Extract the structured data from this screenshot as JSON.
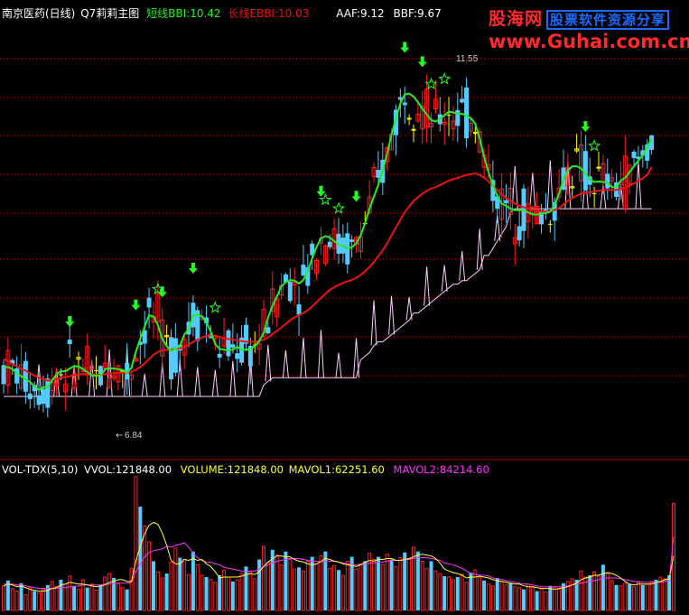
{
  "header": {
    "stock": "南京医药(日线)",
    "indicator": "Q7莉莉主图",
    "short_bbi_label": "短线BBI:",
    "short_bbi_value": "10.42",
    "long_bbi_label": "长线EBBI:",
    "long_bbi_value": "10.03",
    "aaf_label": "AAF:",
    "aaf_value": "9.12",
    "bbf_label": "BBF:",
    "bbf_value": "9.67"
  },
  "watermark": {
    "brand": "股海网",
    "slogan": "股票软件资源分享",
    "url": "www.Guhai.com.cn"
  },
  "price_annotations": {
    "high_label": "11.55",
    "low_label": "6.84"
  },
  "volume_header": {
    "name": "VOL-TDX(5,10)",
    "vvol": "VVOL:121848.00",
    "volume": "VOLUME:121848.00",
    "mavol1": "MAVOL1:62251.60",
    "mavol2": "MAVOL2:84214.60"
  },
  "colors": {
    "background": "#000000",
    "up": "#ff2020",
    "down": "#55ccff",
    "doji": "#ffff00",
    "short_bbi": "#22ee22",
    "long_bbi": "#ee1111",
    "support": "#ffd0ff",
    "mavol1": "#ffff33",
    "mavol2": "#ff33ff",
    "signal": "#22ff22",
    "grid": "#d00000"
  },
  "chart_data": {
    "type": "candlestick",
    "x_count": 153,
    "price_range": [
      6.2,
      12.0
    ],
    "volume_range": [
      0,
      155000
    ],
    "short_bbi_series": [
      7.24,
      7.25,
      7.22,
      7.16,
      7.12,
      7.08,
      7.04,
      6.98,
      6.93,
      6.97,
      6.97,
      7.06,
      7.15,
      7.19,
      7.19,
      7.23,
      7.26,
      7.26,
      7.22,
      7.18,
      7.13,
      7.13,
      7.13,
      7.22,
      7.23,
      7.23,
      7.22,
      7.21,
      7.17,
      7.24,
      7.46,
      7.64,
      7.81,
      7.97,
      7.95,
      7.83,
      7.64,
      7.54,
      7.47,
      7.5,
      7.55,
      7.7,
      7.78,
      7.97,
      7.98,
      7.95,
      7.87,
      7.74,
      7.57,
      7.5,
      7.49,
      7.48,
      7.49,
      7.53,
      7.49,
      7.49,
      7.5,
      7.54,
      7.61,
      7.72,
      7.94,
      8.1,
      8.23,
      8.37,
      8.43,
      8.46,
      8.45,
      8.41,
      8.46,
      8.58,
      8.76,
      8.92,
      9.04,
      9.07,
      9.05,
      9.0,
      8.95,
      8.93,
      8.9,
      8.91,
      8.97,
      9.08,
      9.25,
      9.45,
      9.62,
      9.78,
      9.98,
      10.21,
      10.48,
      10.71,
      10.91,
      11.04,
      11.05,
      11.01,
      10.93,
      10.84,
      10.76,
      10.68,
      10.66,
      10.7,
      10.75,
      10.8,
      10.79,
      10.77,
      10.77,
      10.74,
      10.71,
      10.63,
      10.43,
      10.17,
      9.96,
      9.77,
      9.63,
      9.52,
      9.49,
      9.45,
      9.43,
      9.43,
      9.43,
      9.4,
      9.37,
      9.37,
      9.38,
      9.39,
      9.41,
      9.5,
      9.66,
      9.86,
      9.98,
      10.04,
      10.04,
      10.01,
      9.94,
      9.86,
      9.82,
      9.83,
      9.82,
      9.81,
      9.75,
      9.75,
      9.84,
      9.88,
      9.96,
      10.04,
      10.12,
      10.19,
      10.31,
      10.42
    ],
    "long_bbi_series": [
      7.36,
      7.33,
      7.29,
      7.26,
      7.22,
      7.2,
      7.16,
      7.13,
      7.1,
      7.08,
      7.06,
      7.07,
      7.08,
      7.1,
      7.11,
      7.12,
      7.14,
      7.15,
      7.15,
      7.15,
      7.15,
      7.14,
      7.14,
      7.15,
      7.16,
      7.16,
      7.17,
      7.17,
      7.17,
      7.18,
      7.21,
      7.25,
      7.3,
      7.36,
      7.42,
      7.46,
      7.48,
      7.49,
      7.49,
      7.5,
      7.51,
      7.53,
      7.56,
      7.6,
      7.63,
      7.66,
      7.68,
      7.69,
      7.68,
      7.67,
      7.65,
      7.64,
      7.63,
      7.62,
      7.61,
      7.6,
      7.6,
      7.6,
      7.61,
      7.63,
      7.66,
      7.71,
      7.75,
      7.8,
      7.85,
      7.9,
      7.94,
      7.97,
      8.0,
      8.04,
      8.09,
      8.15,
      8.21,
      8.27,
      8.32,
      8.36,
      8.39,
      8.42,
      8.44,
      8.46,
      8.49,
      8.53,
      8.58,
      8.64,
      8.71,
      8.79,
      8.87,
      8.97,
      9.08,
      9.19,
      9.3,
      9.4,
      9.48,
      9.56,
      9.61,
      9.66,
      9.7,
      9.73,
      9.75,
      9.78,
      9.81,
      9.84,
      9.86,
      9.88,
      9.9,
      9.92,
      9.93,
      9.94,
      9.92,
      9.88,
      9.83,
      9.77,
      9.71,
      9.65,
      9.6,
      9.56,
      9.52,
      9.49,
      9.47,
      9.45,
      9.43,
      9.42,
      9.41,
      9.41,
      9.41,
      9.43,
      9.46,
      9.51,
      9.56,
      9.6,
      9.63,
      9.66,
      9.67,
      9.68,
      9.69,
      9.7,
      9.71,
      9.71,
      9.71,
      9.71,
      9.73,
      9.74,
      9.77,
      9.8,
      9.84,
      9.87,
      9.92,
      10.03
    ],
    "support_series": [
      6.84,
      6.84,
      6.84,
      6.84,
      6.84,
      6.84,
      6.84,
      6.84,
      6.84,
      6.84,
      6.84,
      6.84,
      6.84,
      6.84,
      6.84,
      6.84,
      6.84,
      6.84,
      6.84,
      6.84,
      6.84,
      6.84,
      6.84,
      6.84,
      6.84,
      6.84,
      6.84,
      6.84,
      6.84,
      6.84,
      6.84,
      6.84,
      6.84,
      6.84,
      6.84,
      6.84,
      6.84,
      6.84,
      6.84,
      6.84,
      6.84,
      6.84,
      6.84,
      6.84,
      6.84,
      6.84,
      6.84,
      6.84,
      6.84,
      6.84,
      6.84,
      6.84,
      6.84,
      6.84,
      6.84,
      6.84,
      6.84,
      6.84,
      6.84,
      7.0,
      7.05,
      7.1,
      7.1,
      7.1,
      7.1,
      7.1,
      7.1,
      7.1,
      7.1,
      7.1,
      7.1,
      7.1,
      7.1,
      7.1,
      7.1,
      7.1,
      7.1,
      7.1,
      7.1,
      7.1,
      7.1,
      7.35,
      7.4,
      7.45,
      7.55,
      7.6,
      7.6,
      7.65,
      7.7,
      7.75,
      7.8,
      7.85,
      7.9,
      8.0,
      8.0,
      8.05,
      8.1,
      8.15,
      8.2,
      8.25,
      8.3,
      8.35,
      8.4,
      8.4,
      8.45,
      8.45,
      8.5,
      8.55,
      8.6,
      8.8,
      8.8,
      8.9,
      9.0,
      9.1,
      9.2,
      9.4,
      9.45,
      9.45,
      9.45,
      9.45,
      9.45,
      9.45,
      9.45,
      9.45,
      9.45,
      9.45,
      9.45,
      9.45,
      9.45,
      9.45,
      9.45,
      9.45,
      9.45,
      9.45,
      9.45,
      9.45,
      9.45,
      9.45,
      9.45,
      9.45,
      9.45,
      9.45,
      9.45,
      9.45,
      9.45,
      9.45,
      9.45,
      9.45
    ],
    "signal_arrows_at": [
      15,
      30,
      36,
      43,
      72,
      80,
      91,
      95,
      132
    ],
    "signal_stars_at": [
      35,
      48,
      73,
      76,
      97,
      100,
      134
    ],
    "volume_values": [
      28000,
      34000,
      25000,
      22000,
      31000,
      18000,
      26000,
      22000,
      20000,
      24000,
      29000,
      33000,
      27000,
      35000,
      30000,
      39000,
      28000,
      24000,
      35000,
      26000,
      30000,
      23000,
      28000,
      38000,
      42000,
      37000,
      31000,
      26000,
      24000,
      48000,
      152000,
      118000,
      96000,
      78000,
      56000,
      44000,
      37000,
      42000,
      55000,
      71000,
      60000,
      58000,
      41000,
      67000,
      52000,
      40000,
      38000,
      35000,
      32000,
      40000,
      46000,
      38000,
      33000,
      35000,
      42000,
      50000,
      44000,
      36000,
      58000,
      73000,
      55000,
      69000,
      63000,
      52000,
      67000,
      58000,
      47000,
      49000,
      45000,
      56000,
      61000,
      53000,
      62000,
      67000,
      48000,
      51000,
      46000,
      40000,
      56000,
      61000,
      47000,
      53000,
      56000,
      65000,
      58000,
      61000,
      52000,
      64000,
      58000,
      50000,
      60000,
      66000,
      59000,
      72000,
      67000,
      56000,
      48000,
      56000,
      45000,
      42000,
      39000,
      38000,
      35000,
      38000,
      41000,
      32000,
      43000,
      46000,
      38000,
      34000,
      30000,
      28000,
      37000,
      33000,
      29000,
      31000,
      27000,
      26000,
      24000,
      30000,
      27000,
      22000,
      25000,
      21000,
      28000,
      26000,
      24000,
      31000,
      33000,
      36000,
      35000,
      45000,
      38000,
      40000,
      44000,
      39000,
      52000,
      42000,
      34000,
      29000,
      28000,
      31000,
      30000,
      27000,
      32000,
      29000,
      30000,
      33000,
      35000,
      38000,
      36000,
      40000,
      121848
    ],
    "mavol1_series": [
      28000,
      30000,
      29000,
      27000,
      28000,
      26000,
      24000,
      23000,
      22000,
      22000,
      23000,
      25000,
      26000,
      29000,
      30000,
      32000,
      31000,
      30000,
      30000,
      29000,
      28000,
      27000,
      28000,
      29000,
      32000,
      33000,
      35000,
      35000,
      33000,
      33000,
      56000,
      73000,
      87000,
      97000,
      100000,
      98000,
      88000,
      74000,
      57000,
      53000,
      53000,
      58000,
      57000,
      59000,
      57000,
      58000,
      53000,
      50000,
      44000,
      37000,
      38000,
      38000,
      38000,
      38000,
      39000,
      41000,
      42000,
      41000,
      44000,
      50000,
      55000,
      59000,
      62000,
      62000,
      61000,
      61000,
      58000,
      56000,
      55000,
      53000,
      52000,
      53000,
      56000,
      59000,
      58000,
      56000,
      55000,
      53000,
      52000,
      51000,
      50000,
      52000,
      55000,
      57000,
      56000,
      58000,
      58000,
      59000,
      59000,
      57000,
      57000,
      58000,
      59000,
      61000,
      63000,
      64000,
      63000,
      62000,
      59000,
      54000,
      47000,
      45000,
      43000,
      42000,
      40000,
      37000,
      38000,
      38000,
      39000,
      38000,
      37000,
      35000,
      34000,
      33000,
      32000,
      31000,
      30000,
      30000,
      28000,
      27000,
      27000,
      26000,
      25000,
      25000,
      25000,
      24000,
      25000,
      26000,
      27000,
      29000,
      31000,
      35000,
      37000,
      38000,
      40000,
      40000,
      42000,
      43000,
      42000,
      40000,
      37000,
      33000,
      30000,
      29000,
      30000,
      30000,
      30000,
      30000,
      32000,
      33000,
      35000,
      36000,
      62252
    ],
    "mavol2_series": [
      30000,
      30000,
      30000,
      29000,
      29000,
      28000,
      27000,
      26000,
      25000,
      25000,
      25000,
      25000,
      25000,
      26000,
      26000,
      27000,
      27000,
      28000,
      29000,
      29000,
      29000,
      29000,
      29000,
      30000,
      30000,
      31000,
      31000,
      31000,
      31000,
      32000,
      44000,
      53000,
      61000,
      66000,
      68000,
      69000,
      70000,
      73000,
      72000,
      74000,
      75000,
      77000,
      72000,
      65000,
      60000,
      57000,
      55000,
      55000,
      53000,
      52000,
      49000,
      48000,
      47000,
      46000,
      45000,
      45000,
      45000,
      45000,
      47000,
      50000,
      52000,
      54000,
      56000,
      57000,
      58000,
      59000,
      59000,
      59000,
      58000,
      57000,
      56000,
      56000,
      55000,
      56000,
      56000,
      56000,
      55000,
      54000,
      53000,
      52000,
      52000,
      52000,
      53000,
      54000,
      54000,
      55000,
      55000,
      56000,
      57000,
      57000,
      57000,
      58000,
      58000,
      59000,
      60000,
      60000,
      60000,
      59000,
      58000,
      57000,
      54000,
      53000,
      52000,
      50000,
      48000,
      45000,
      42000,
      41000,
      40000,
      40000,
      39000,
      37000,
      36000,
      35000,
      34000,
      33000,
      32000,
      31000,
      30000,
      30000,
      29000,
      28000,
      27000,
      27000,
      27000,
      27000,
      27000,
      27000,
      28000,
      29000,
      30000,
      31000,
      32000,
      33000,
      34000,
      35000,
      37000,
      37000,
      37000,
      37000,
      36000,
      35000,
      34000,
      33000,
      33000,
      32000,
      32000,
      32000,
      32000,
      32000,
      33000,
      34000,
      84215
    ]
  }
}
